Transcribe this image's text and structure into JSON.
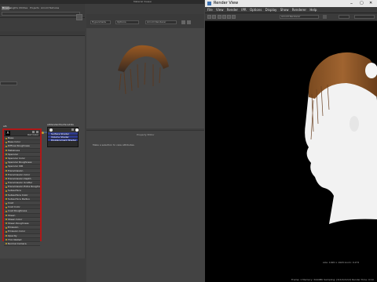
{
  "hypershade": {
    "top_title": "Material Viewer",
    "graph_title": "Hypershade Graph",
    "tabs": [
      "Browse",
      "Lights",
      "Utilities",
      "Projects",
      "Arnold Textures"
    ],
    "active_tab": "Browse",
    "left_toolbar_dropdowns": [
      "Hypershade",
      "Options",
      "Arnold Renderer"
    ],
    "property_panel_title": "Property Editor",
    "property_panel_message": "Make a selection to view attributes."
  },
  "node_ai": {
    "title": "aiS",
    "header_label": "Out Color",
    "attributes": [
      "Base",
      "Base Color",
      "Diffuse Roughness",
      "Metalness",
      "Specular",
      "Specular Color",
      "Specular Roughness",
      "Specular IOR",
      "Transmission",
      "Transmission Color",
      "Transmission Depth",
      "Transmission Scatter",
      "Transmission Extra Roughness",
      "Subsurface",
      "Subsurface Color",
      "Subsurface Radius",
      "Coat",
      "Coat Color",
      "Coat Roughness",
      "Sheen",
      "Sheen Color",
      "Sheen Roughness",
      "Emission",
      "Emission Color",
      "Opacity",
      "Thin Walled",
      "Normal Camera"
    ]
  },
  "node_sg": {
    "title": "aiStandardSurface1SG",
    "rows": [
      "Surface Shader",
      "Volume Shader",
      "Displacement Shader"
    ]
  },
  "render_view": {
    "title": "Render View",
    "menu": [
      "File",
      "View",
      "Render",
      "IPR",
      "Options",
      "Display",
      "Show",
      "Renderer",
      "Help"
    ],
    "camera": "persp",
    "renderer": "Arnold Renderer",
    "status_line1": "size: 1920 x 1920  zoom: 0.272",
    "status_line2": "Frame: 1   Memory: 3444Mb   Sampling: [3/2/2/2/2/2]   Render Time: 0:19"
  },
  "colors": {
    "highlight_red": "#b01818",
    "sg_blue": "#2e3a8c",
    "hair": "#8a5522"
  }
}
